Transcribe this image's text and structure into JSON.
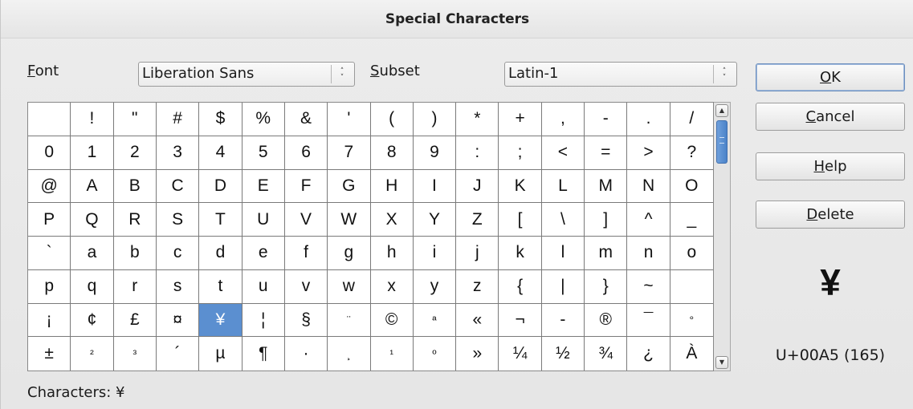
{
  "dialog": {
    "title": "Special Characters"
  },
  "font": {
    "label_prefix": "",
    "label_mnemonic": "F",
    "label_rest": "ont",
    "value": "Liberation Sans"
  },
  "subset": {
    "label_mnemonic": "S",
    "label_rest": "ubset",
    "value": "Latin-1"
  },
  "buttons": {
    "ok": {
      "mnemonic": "O",
      "rest": "K"
    },
    "cancel": {
      "mnemonic": "C",
      "rest": "ancel"
    },
    "help": {
      "mnemonic": "H",
      "rest": "elp"
    },
    "delete": {
      "mnemonic": "D",
      "rest": "elete"
    }
  },
  "grid": {
    "rows": [
      [
        " ",
        "!",
        "\"",
        "#",
        "$",
        "%",
        "&",
        "'",
        "(",
        ")",
        "*",
        "+",
        ",",
        "-",
        ".",
        "/"
      ],
      [
        "0",
        "1",
        "2",
        "3",
        "4",
        "5",
        "6",
        "7",
        "8",
        "9",
        ":",
        ";",
        "<",
        "=",
        ">",
        "?"
      ],
      [
        "@",
        "A",
        "B",
        "C",
        "D",
        "E",
        "F",
        "G",
        "H",
        "I",
        "J",
        "K",
        "L",
        "M",
        "N",
        "O"
      ],
      [
        "P",
        "Q",
        "R",
        "S",
        "T",
        "U",
        "V",
        "W",
        "X",
        "Y",
        "Z",
        "[",
        "\\",
        "]",
        "^",
        "_"
      ],
      [
        "`",
        "a",
        "b",
        "c",
        "d",
        "e",
        "f",
        "g",
        "h",
        "i",
        "j",
        "k",
        "l",
        "m",
        "n",
        "o"
      ],
      [
        "p",
        "q",
        "r",
        "s",
        "t",
        "u",
        "v",
        "w",
        "x",
        "y",
        "z",
        "{",
        "|",
        "}",
        "~",
        ""
      ],
      [
        "¡",
        "¢",
        "£",
        "¤",
        "¥",
        "¦",
        "§",
        "¨",
        "©",
        "ª",
        "«",
        "¬",
        "-",
        "®",
        "¯",
        "°"
      ],
      [
        "±",
        "²",
        "³",
        "´",
        "µ",
        "¶",
        "·",
        "¸",
        "¹",
        "º",
        "»",
        "¼",
        "½",
        "¾",
        "¿",
        "À"
      ]
    ],
    "selected": "¥"
  },
  "preview": {
    "char": "¥",
    "code": "U+00A5 (165)"
  },
  "status": {
    "text": "Characters: ¥"
  },
  "icons": {
    "combo_arrows": "up-down-chevron-icon",
    "scroll_up": "scroll-up-arrow-icon",
    "scroll_down": "scroll-down-arrow-icon"
  },
  "colors": {
    "selection": "#5b8fd0",
    "scroll_thumb": "#4b83c9"
  }
}
